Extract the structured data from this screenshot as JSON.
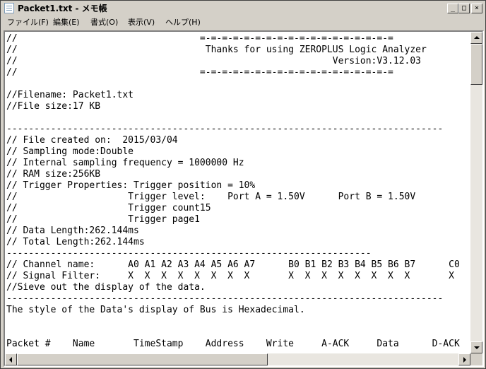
{
  "window": {
    "title": "Packet1.txt - メモ帳"
  },
  "caption_buttons": {
    "minimize": "_",
    "maximize": "□",
    "close": "×"
  },
  "menu": [
    "ファイル(F)",
    "編集(E)",
    "書式(O)",
    "表示(V)",
    "ヘルプ(H)"
  ],
  "editor_lines": [
    "//                                 =-=-=-=-=-=-=-=-=-=-=-=-=-=-=-=-=-=",
    "//                                  Thanks for using ZEROPLUS Logic Analyzer",
    "//                                                         Version:V3.12.03",
    "//                                 =-=-=-=-=-=-=-=-=-=-=-=-=-=-=-=-=-=",
    "",
    "//Filename: Packet1.txt",
    "//File size:17 KB",
    "",
    "-------------------------------------------------------------------------------",
    "// File created on:  2015/03/04",
    "// Sampling mode:Double",
    "// Internal sampling frequency = 1000000 Hz",
    "// RAM size:256KB",
    "// Trigger Properties: Trigger position = 10%",
    "//                    Trigger level:    Port A = 1.50V      Port B = 1.50V",
    "//                    Trigger count15",
    "//                    Trigger page1",
    "// Data Length:262.144ms",
    "// Total Length:262.144ms",
    "------------------------------------------------------------------",
    "// Channel name:      A0 A1 A2 A3 A4 A5 A6 A7      B0 B1 B2 B3 B4 B5 B6 B7      C0",
    "// Signal Filter:     X  X  X  X  X  X  X  X       X  X  X  X  X  X  X  X       X",
    "//Sieve out the display of the data.",
    "-------------------------------------------------------------------------------",
    "The style of the Data's display of Bus is Hexadecimal.",
    "",
    "",
    "Packet #    Name       TimeStamp    Address    Write     A-ACK     Data      D-ACK"
  ]
}
